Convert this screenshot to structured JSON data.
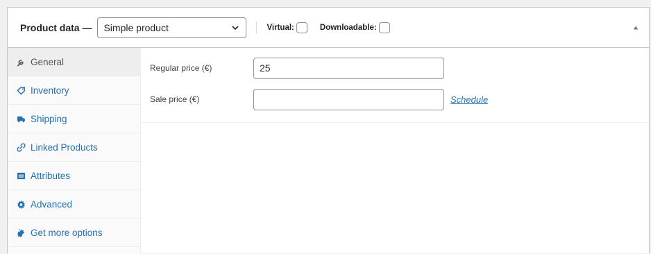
{
  "header": {
    "title": "Product data —",
    "product_type": "Simple product",
    "virtual_label": "Virtual:",
    "virtual_checked": false,
    "downloadable_label": "Downloadable:",
    "downloadable_checked": false,
    "collapse_icon": "triangle-up-icon"
  },
  "sidebar": {
    "items": [
      {
        "label": "General",
        "icon": "wrench-icon",
        "active": true
      },
      {
        "label": "Inventory",
        "icon": "tag-icon",
        "active": false
      },
      {
        "label": "Shipping",
        "icon": "truck-icon",
        "active": false
      },
      {
        "label": "Linked Products",
        "icon": "link-icon",
        "active": false
      },
      {
        "label": "Attributes",
        "icon": "list-icon",
        "active": false
      },
      {
        "label": "Advanced",
        "icon": "gear-icon",
        "active": false
      },
      {
        "label": "Get more options",
        "icon": "plugin-icon",
        "active": false
      }
    ]
  },
  "general": {
    "regular_price_label": "Regular price (€)",
    "regular_price_value": "25",
    "sale_price_label": "Sale price (€)",
    "sale_price_value": "",
    "schedule_link": "Schedule"
  },
  "colors": {
    "link": "#2271b1",
    "active_tab_bg": "#eeeeee",
    "border": "#c3c4c7"
  }
}
